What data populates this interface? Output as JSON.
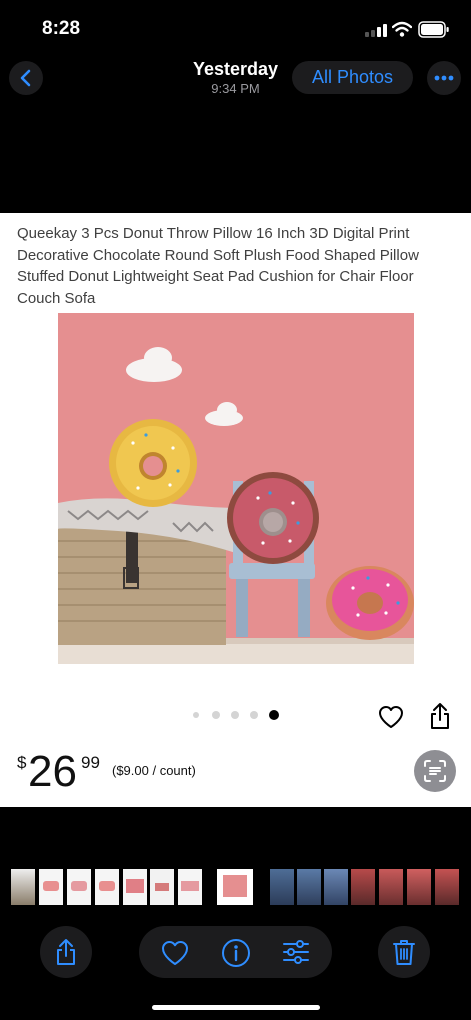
{
  "status_bar": {
    "time": "8:28"
  },
  "nav": {
    "title": "Yesterday",
    "subtitle": "9:34 PM",
    "all_photos_label": "All Photos"
  },
  "product": {
    "title": "Queekay 3 Pcs Donut Throw Pillow 16 Inch 3D Digital Print Decorative Chocolate Round Soft Plush Food Shaped Pillow Stuffed Donut Lightweight Seat Pad Cushion for Chair Floor Couch Sofa",
    "currency_symbol": "$",
    "price_whole": "26",
    "price_fraction": "99",
    "unit_price": "($9.00 / count)",
    "image_count": 5,
    "active_image_index": 5
  },
  "colors": {
    "accent_blue": "#2f8dff",
    "wall_pink": "#e58f90",
    "icon_grey": "#8e8e93"
  },
  "icons": {
    "back": "chevron-left-icon",
    "more": "ellipsis-icon",
    "favorite": "heart-icon",
    "share": "share-icon",
    "live_text": "live-text-icon",
    "info": "info-icon",
    "adjust": "adjust-sliders-icon",
    "delete": "trash-icon"
  }
}
